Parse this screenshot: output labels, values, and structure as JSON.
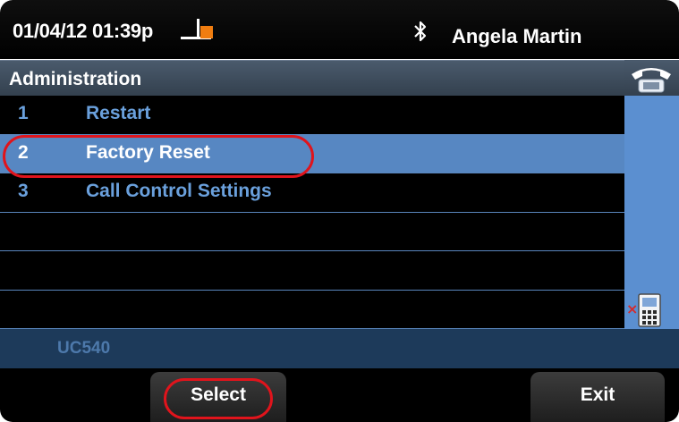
{
  "status": {
    "datetime": "01/04/12 01:39p",
    "user_name": "Angela Martin"
  },
  "menu": {
    "title": "Administration",
    "items": [
      {
        "number": "1",
        "label": "Restart",
        "selected": false
      },
      {
        "number": "2",
        "label": "Factory Reset",
        "selected": true
      },
      {
        "number": "3",
        "label": "Call Control Settings",
        "selected": false
      },
      {
        "number": "",
        "label": "",
        "selected": false
      },
      {
        "number": "",
        "label": "",
        "selected": false
      },
      {
        "number": "",
        "label": "",
        "selected": false
      }
    ]
  },
  "model": "UC540",
  "softkeys": {
    "select": "Select",
    "exit": "Exit"
  },
  "icons": {
    "handset": "off-hook-handset-icon",
    "bluetooth": "bluetooth-icon",
    "phone": "phone-line-icon",
    "contacts": "missed-call-contacts-icon"
  },
  "colors": {
    "selected_row": "#5787c2",
    "item_text": "#6aa0dc",
    "highlight": "#e0141c",
    "model_bar": "#1d3a5a"
  }
}
